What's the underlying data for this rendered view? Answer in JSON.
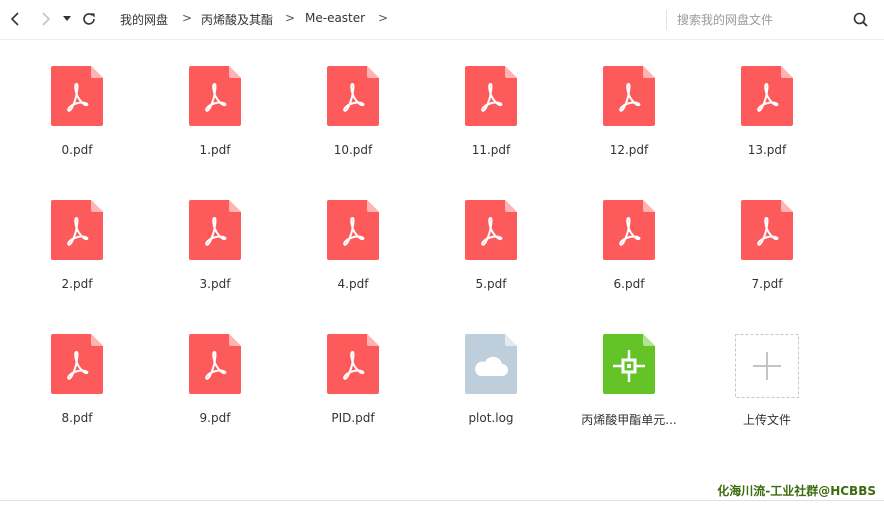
{
  "toolbar": {
    "back_icon": "chevron-left-icon",
    "forward_icon": "chevron-right-icon",
    "dropdown_icon": "caret-down-icon",
    "refresh_icon": "refresh-icon",
    "breadcrumb": [
      {
        "label": "我的网盘"
      },
      {
        "label": "丙烯酸及其酯"
      },
      {
        "label": "Me-easter"
      }
    ],
    "separator": ">",
    "search_placeholder": "搜索我的网盘文件",
    "search_icon": "search-icon"
  },
  "files": [
    {
      "name": "0.pdf",
      "type": "pdf"
    },
    {
      "name": "1.pdf",
      "type": "pdf"
    },
    {
      "name": "10.pdf",
      "type": "pdf"
    },
    {
      "name": "11.pdf",
      "type": "pdf"
    },
    {
      "name": "12.pdf",
      "type": "pdf"
    },
    {
      "name": "13.pdf",
      "type": "pdf"
    },
    {
      "name": "2.pdf",
      "type": "pdf"
    },
    {
      "name": "3.pdf",
      "type": "pdf"
    },
    {
      "name": "4.pdf",
      "type": "pdf"
    },
    {
      "name": "5.pdf",
      "type": "pdf"
    },
    {
      "name": "6.pdf",
      "type": "pdf"
    },
    {
      "name": "7.pdf",
      "type": "pdf"
    },
    {
      "name": "8.pdf",
      "type": "pdf"
    },
    {
      "name": "9.pdf",
      "type": "pdf"
    },
    {
      "name": "PID.pdf",
      "type": "pdf"
    },
    {
      "name": "plot.log",
      "type": "log"
    },
    {
      "name": "丙烯酸甲酯单元...",
      "type": "cad"
    }
  ],
  "upload": {
    "label": "上传文件",
    "icon": "plus-icon"
  },
  "watermark": "化海川流-工业社群@HCBBS",
  "colors": {
    "pdf": "#fd5b5b",
    "pdf_fold": "#ffb3b3",
    "log": "#bfcedb",
    "log_fold": "#e3eaf1",
    "cad": "#63c327",
    "cad_fold": "#b3e290",
    "watermark": "#3d6b0f"
  }
}
